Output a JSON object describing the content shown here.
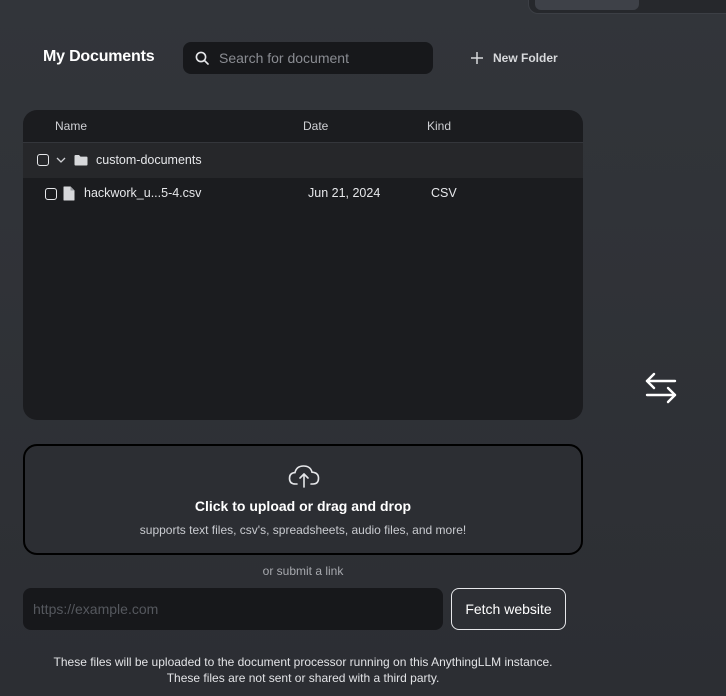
{
  "header": {
    "title": "My Documents",
    "search_placeholder": "Search for document",
    "new_folder_label": "New Folder"
  },
  "file_table": {
    "columns": [
      "Name",
      "Date",
      "Kind"
    ],
    "folder": {
      "name": "custom-documents",
      "expanded": true,
      "checked": false
    },
    "files": [
      {
        "name": "hackwork_u...5-4.csv",
        "date": "Jun 21, 2024",
        "kind": "CSV",
        "checked": false
      }
    ]
  },
  "upload": {
    "title": "Click to upload or drag and drop",
    "subtitle": "supports text files, csv's, spreadsheets, audio files, and more!",
    "or_text": "or submit a link",
    "url_placeholder": "https://example.com",
    "fetch_label": "Fetch website"
  },
  "footer": {
    "line1": "These files will be uploaded to the document processor running on this AnythingLLM instance.",
    "line2": "These files are not sent or shared with a third party."
  },
  "icons": {
    "search": "search-icon",
    "plus": "plus-icon",
    "folder": "folder-icon",
    "file": "file-icon",
    "chevron": "chevron-down-icon",
    "upload": "cloud-upload-icon",
    "swap": "arrows-left-right-icon"
  },
  "colors": {
    "background": "#2c2e33",
    "panel": "#1b1c1f",
    "input": "#17181b",
    "text": "#ffffff"
  }
}
